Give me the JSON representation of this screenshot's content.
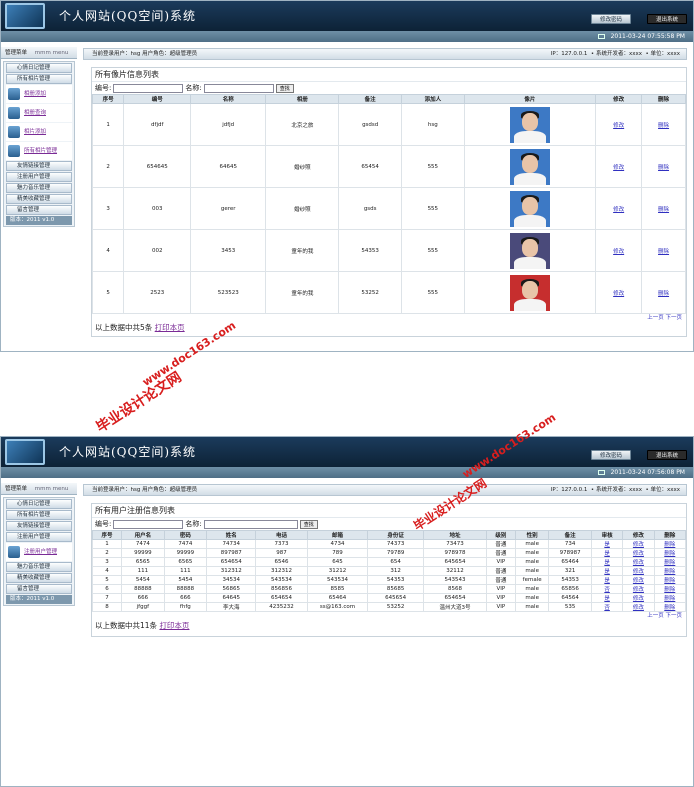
{
  "app_title": "个人网站(QQ空间)系统",
  "top_buttons": {
    "change_pwd": "修改密码",
    "logout": "退出系统"
  },
  "screen1": {
    "datetime": "2011-03-24 07:55:58 PM",
    "menu_header": "管理菜单",
    "menu_header_en": "mmm menu",
    "info_left": "当前登录用户：hsg  用户角色：超级管理员",
    "info_ip": "IP：127.0.0.1",
    "info_dev": "系统开发者：xxxx",
    "info_unit": "单位：xxxx",
    "sidebar": {
      "items_top": [
        "心情日记管理",
        "所有相片管理"
      ],
      "big_items": [
        "相册添加",
        "相册查询",
        "相片添加",
        "所有相片管理"
      ],
      "items_bottom": [
        "友情链接管理",
        "注册用户管理",
        "魅力音乐管理",
        "精美收藏管理",
        "留言管理"
      ],
      "version": "版本：2011 v1.0"
    },
    "panel_title": "所有像片信息列表",
    "search": {
      "id_label": "编号:",
      "name_label": "名称:",
      "button": "查找"
    },
    "columns": [
      "序号",
      "编号",
      "名称",
      "相册",
      "备注",
      "添加人",
      "像片",
      "修改",
      "删除"
    ],
    "rows": [
      [
        "1",
        "dfjdf",
        "jdfjd",
        "北京之旅",
        "gsdsd",
        "hsg",
        "修改",
        "删除"
      ],
      [
        "2",
        "654645",
        "64645",
        "婚纱照",
        "65454",
        "555",
        "修改",
        "删除"
      ],
      [
        "3",
        "003",
        "gerer",
        "婚纱照",
        "gsds",
        "555",
        "修改",
        "删除"
      ],
      [
        "4",
        "002",
        "3453",
        "童年的我",
        "54353",
        "555",
        "修改",
        "删除"
      ],
      [
        "5",
        "2523",
        "523523",
        "童年的我",
        "53252",
        "555",
        "修改",
        "删除"
      ]
    ],
    "pager": "上一页  下一页",
    "footer_text": "以上数据中共5条",
    "footer_link": "打印本页"
  },
  "screen2": {
    "datetime": "2011-03-24 07:56:08 PM",
    "menu_header": "管理菜单",
    "menu_header_en": "mmm menu",
    "info_left": "当前登录用户：hsg  用户角色：超级管理员",
    "info_ip": "IP：127.0.0.1",
    "info_dev": "系统开发者：xxxx",
    "info_unit": "单位：xxxx",
    "sidebar": {
      "items_top": [
        "心情日记管理",
        "所有相片管理",
        "友情链接管理",
        "注册用户管理"
      ],
      "big_items": [
        "注册用户管理"
      ],
      "items_bottom": [
        "魅力音乐管理",
        "精美收藏管理",
        "留言管理"
      ],
      "version": "版本：2011 v1.0"
    },
    "panel_title": "所有用户注册信息列表",
    "search": {
      "id_label": "编号:",
      "name_label": "名称:",
      "button": "查找"
    },
    "columns": [
      "序号",
      "用户名",
      "密码",
      "姓名",
      "电话",
      "邮箱",
      "身份证",
      "地址",
      "级别",
      "性别",
      "备注",
      "审核",
      "修改",
      "删除"
    ],
    "rows": [
      [
        "1",
        "7474",
        "7474",
        "74734",
        "7373",
        "4734",
        "74373",
        "73473",
        "普通",
        "male",
        "734",
        "是",
        "修改",
        "删除"
      ],
      [
        "2",
        "99999",
        "99999",
        "897987",
        "987",
        "789",
        "79789",
        "978978",
        "普通",
        "male",
        "978987",
        "是",
        "修改",
        "删除"
      ],
      [
        "3",
        "6565",
        "6565",
        "654654",
        "6546",
        "645",
        "654",
        "645654",
        "VIP",
        "male",
        "65464",
        "是",
        "修改",
        "删除"
      ],
      [
        "4",
        "111",
        "111",
        "312312",
        "312312",
        "31212",
        "312",
        "32112",
        "普通",
        "male",
        "321",
        "是",
        "修改",
        "删除"
      ],
      [
        "5",
        "5454",
        "5454",
        "34534",
        "543534",
        "543534",
        "54353",
        "543543",
        "普通",
        "female",
        "54353",
        "是",
        "修改",
        "删除"
      ],
      [
        "6",
        "88888",
        "88888",
        "56865",
        "856856",
        "8585",
        "85685",
        "8568",
        "VIP",
        "male",
        "65856",
        "否",
        "修改",
        "删除"
      ],
      [
        "7",
        "666",
        "666",
        "64645",
        "654654",
        "65464",
        "645654",
        "654654",
        "VIP",
        "male",
        "64564",
        "是",
        "修改",
        "删除"
      ],
      [
        "8",
        "jfggf",
        "fhfg",
        "李大海",
        "4235232",
        "ss@163.com",
        "53252",
        "温州大道3号",
        "VIP",
        "male",
        "535",
        "否",
        "修改",
        "删除"
      ]
    ],
    "pager": "上一页  下一页",
    "footer_text": "以上数据中共11条",
    "footer_link": "打印本页"
  },
  "watermarks": [
    "毕业设计论文网",
    "www.doc163.com",
    "毕业设计论文网",
    "www.doc163.com"
  ],
  "colors": {
    "header_dark": "#0d2236",
    "link": "#3030c0",
    "watermark": "#d81e1e"
  }
}
